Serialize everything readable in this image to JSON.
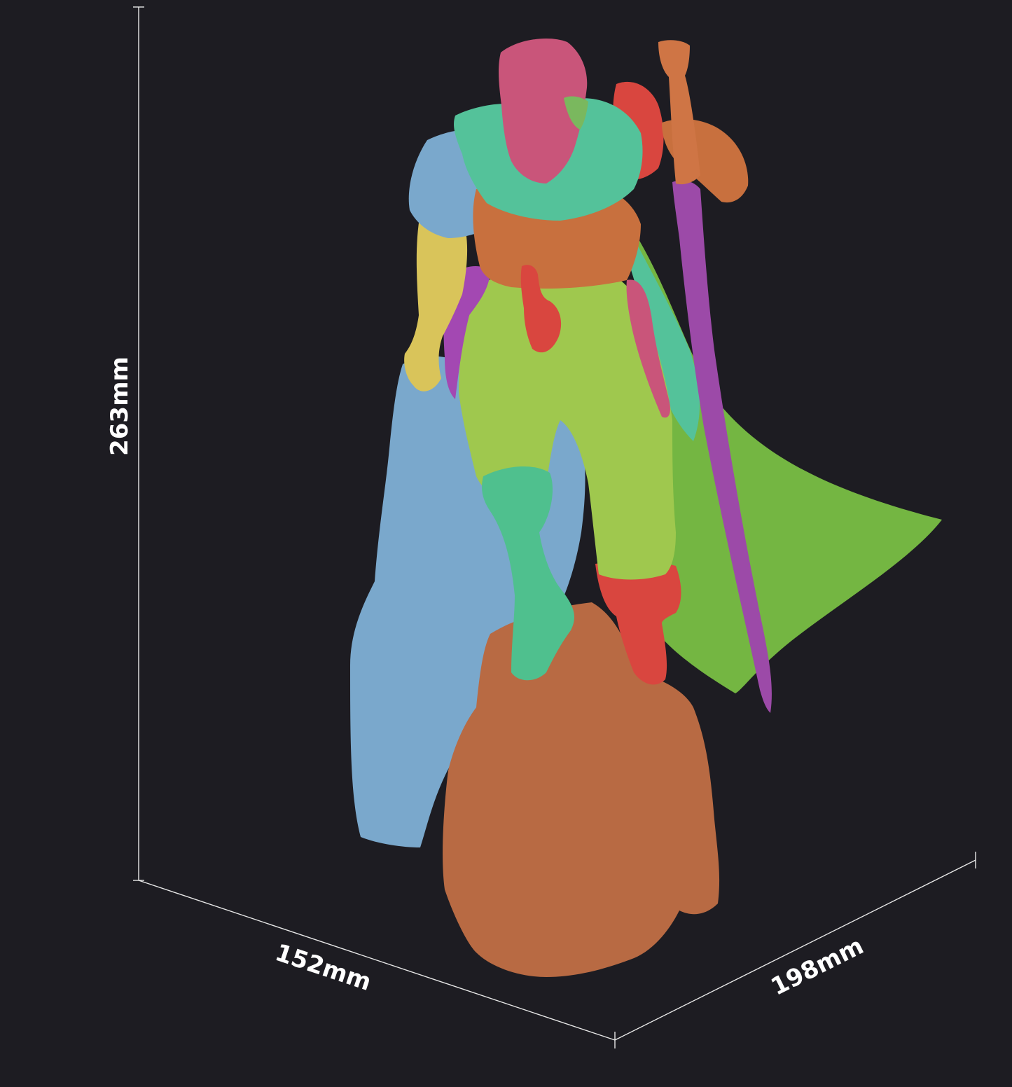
{
  "dimensions": {
    "height": "263mm",
    "depth": "152mm",
    "width": "198mm"
  },
  "colors": {
    "background": "#1d1c22",
    "dimension_lines": "#e8e8e8",
    "dimension_text": "#ffffff",
    "rock_left": "#7aa8cc",
    "rock_front": "#b86a43",
    "skin": "#c9557a",
    "hair_tips": "#7ab85e",
    "scarf": "#54c29a",
    "cape": "#74b642",
    "cape_inner": "#54c29a",
    "shoulder_left": "#7aa8cc",
    "shoulder_right": "#d9463f",
    "arm_left": "#d9c45a",
    "torso_armor": "#c8703e",
    "pants": "#9fc84e",
    "boot_left": "#4fc08e",
    "boot_right": "#d9463f",
    "belt_strap": "#a348b2",
    "dagger": "#d9463f",
    "sword_blade": "#9c4aa8",
    "sword_hilt": "#cf7545",
    "gauntlet_right": "#c8703e"
  }
}
